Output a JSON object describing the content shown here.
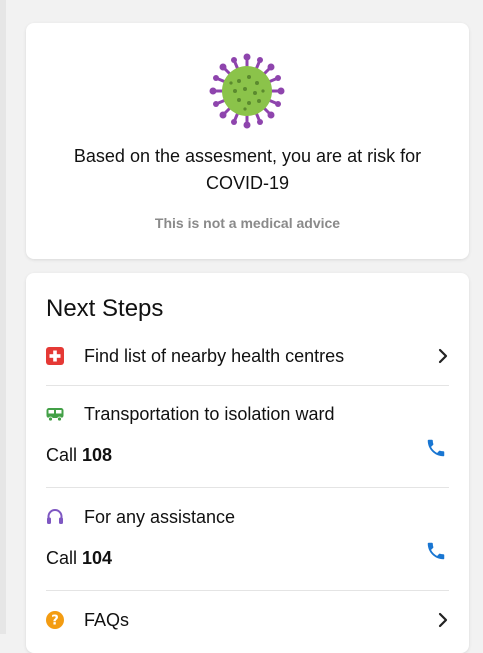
{
  "assessment": {
    "icon": "virus-icon",
    "result_text": "Based on the assesment, you are at risk for COVID-19",
    "disclaimer": "This is not a medical advice"
  },
  "next_steps": {
    "title": "Next Steps",
    "items": [
      {
        "label": "Find list of nearby health centres",
        "icon": "medical-cross-icon",
        "action_icon": "chevron-right-icon"
      },
      {
        "label": "Transportation to isolation ward",
        "icon": "bus-icon",
        "call_prefix": "Call",
        "call_number": "108",
        "action_icon": "phone-icon"
      },
      {
        "label": "For any assistance",
        "icon": "headset-icon",
        "call_prefix": "Call",
        "call_number": "104",
        "action_icon": "phone-icon"
      },
      {
        "label": "FAQs",
        "icon": "question-icon",
        "action_icon": "chevron-right-icon"
      }
    ]
  },
  "colors": {
    "virus_body": "#8bc34a",
    "virus_spikes": "#8e44ad",
    "medical_red": "#e53935",
    "bus_green": "#43a047",
    "headset_purple": "#7e57c2",
    "faq_orange": "#f39c12",
    "phone_blue": "#1976d2",
    "disclaimer_gray": "#8a8a8a"
  }
}
